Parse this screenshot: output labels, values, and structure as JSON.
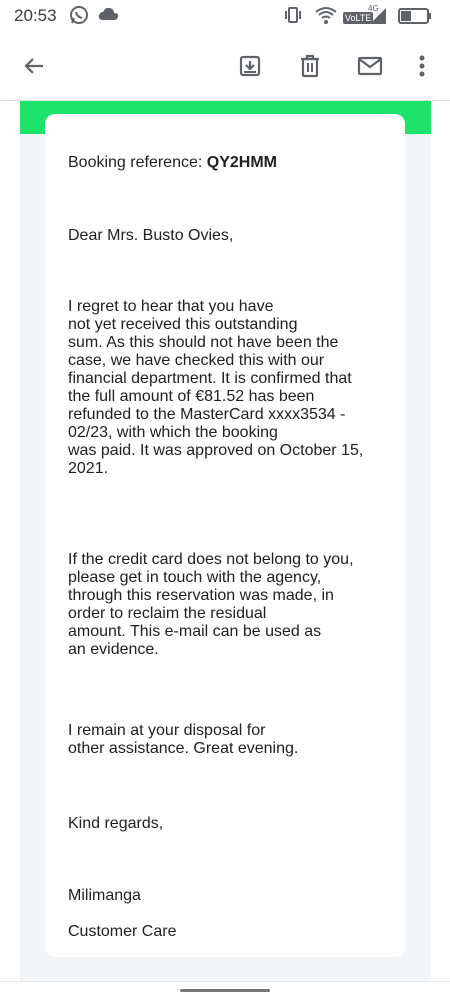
{
  "status_bar": {
    "time": "20:53",
    "left_icons": [
      "whatsapp-icon",
      "cloud-icon"
    ],
    "right_icons": [
      "vibrate-icon",
      "wifi-icon",
      "volte-icon",
      "signal-icon",
      "battery-icon"
    ],
    "volte_label": "VoLTE",
    "network_label": "4G"
  },
  "app_bar": {
    "icons": [
      "back-arrow-icon",
      "archive-icon",
      "delete-icon",
      "mark-unread-icon",
      "more-vert-icon"
    ]
  },
  "colors": {
    "accent_green": "#1ee36b",
    "frame_bg": "#f1f5f8"
  },
  "email": {
    "booking_label": "Booking reference: ",
    "booking_ref": "QY2HMM",
    "greeting": "Dear Mrs. Busto Ovies,",
    "paragraph1": [
      "I regret to hear that you have",
      "not yet received this outstanding",
      "sum. As this should not have been the",
      "case, we have checked this with our",
      "financial department. It is confirmed that",
      "the full amount of €81.52 has been",
      "refunded to the MasterCard xxxx3534 -",
      "02/23, with which the booking",
      "was paid. It was approved on October 15,",
      "2021."
    ],
    "paragraph2": [
      "If the credit card does not belong to you,",
      "please get in touch with the agency,",
      "through this reservation was made, in",
      "order to reclaim the residual",
      "amount. This e-mail can be used as",
      "an evidence."
    ],
    "paragraph3": [
      "I remain at your disposal for",
      "other assistance. Great evening."
    ],
    "closing": "Kind regards,",
    "signature_name": "Milimanga",
    "signature_dept": "Customer Care"
  }
}
